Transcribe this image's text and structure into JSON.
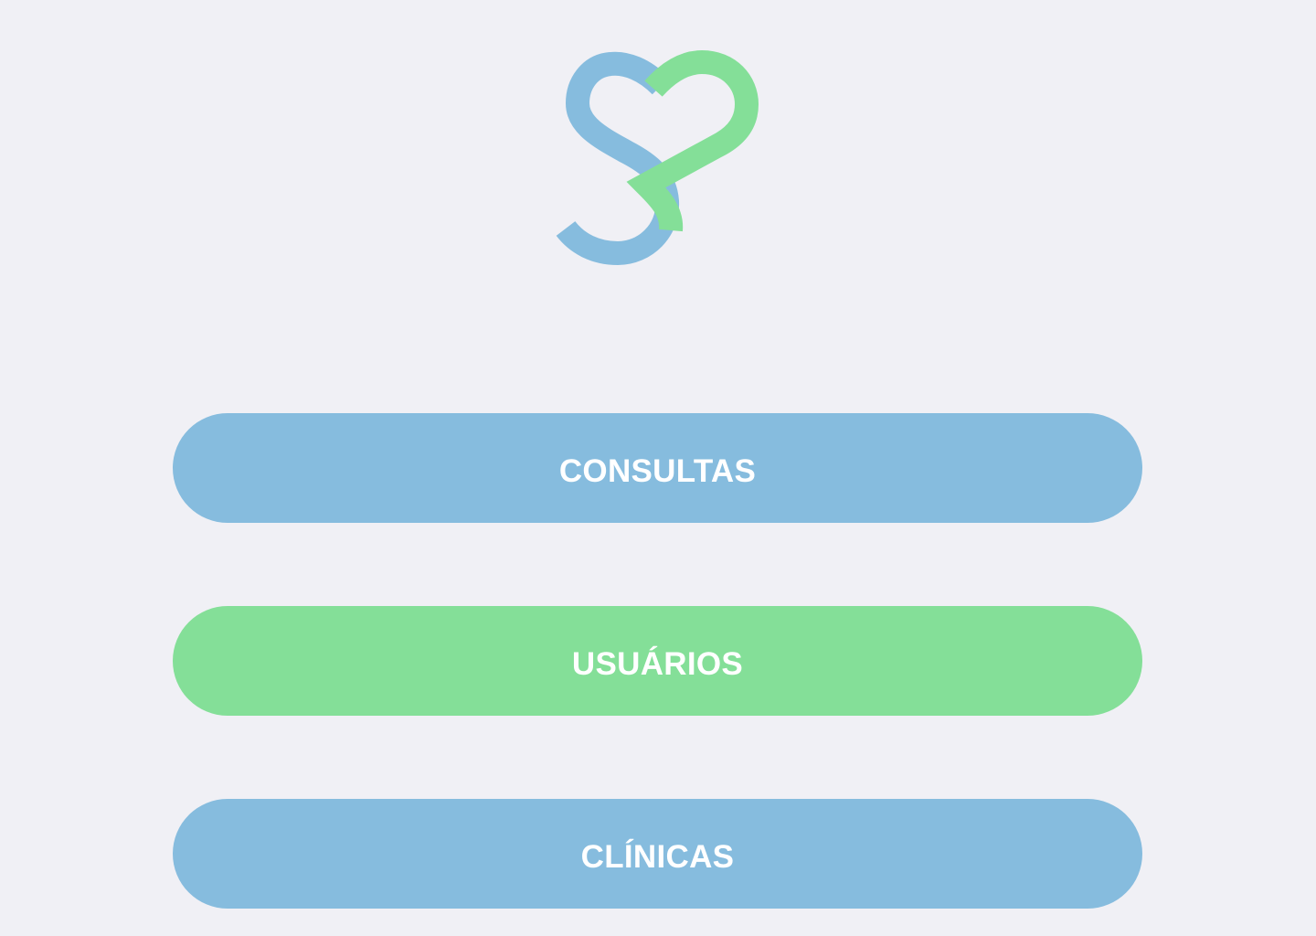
{
  "colors": {
    "background": "#f0f0f5",
    "blue": "#86bcde",
    "green": "#84df98",
    "text": "#ffffff"
  },
  "logo": {
    "icon": "heart-s-logo-icon"
  },
  "menu": {
    "buttons": [
      {
        "label": "CONSULTAS",
        "color": "#86bcde"
      },
      {
        "label": "USUÁRIOS",
        "color": "#84df98"
      },
      {
        "label": "CLÍNICAS",
        "color": "#86bcde"
      }
    ]
  }
}
